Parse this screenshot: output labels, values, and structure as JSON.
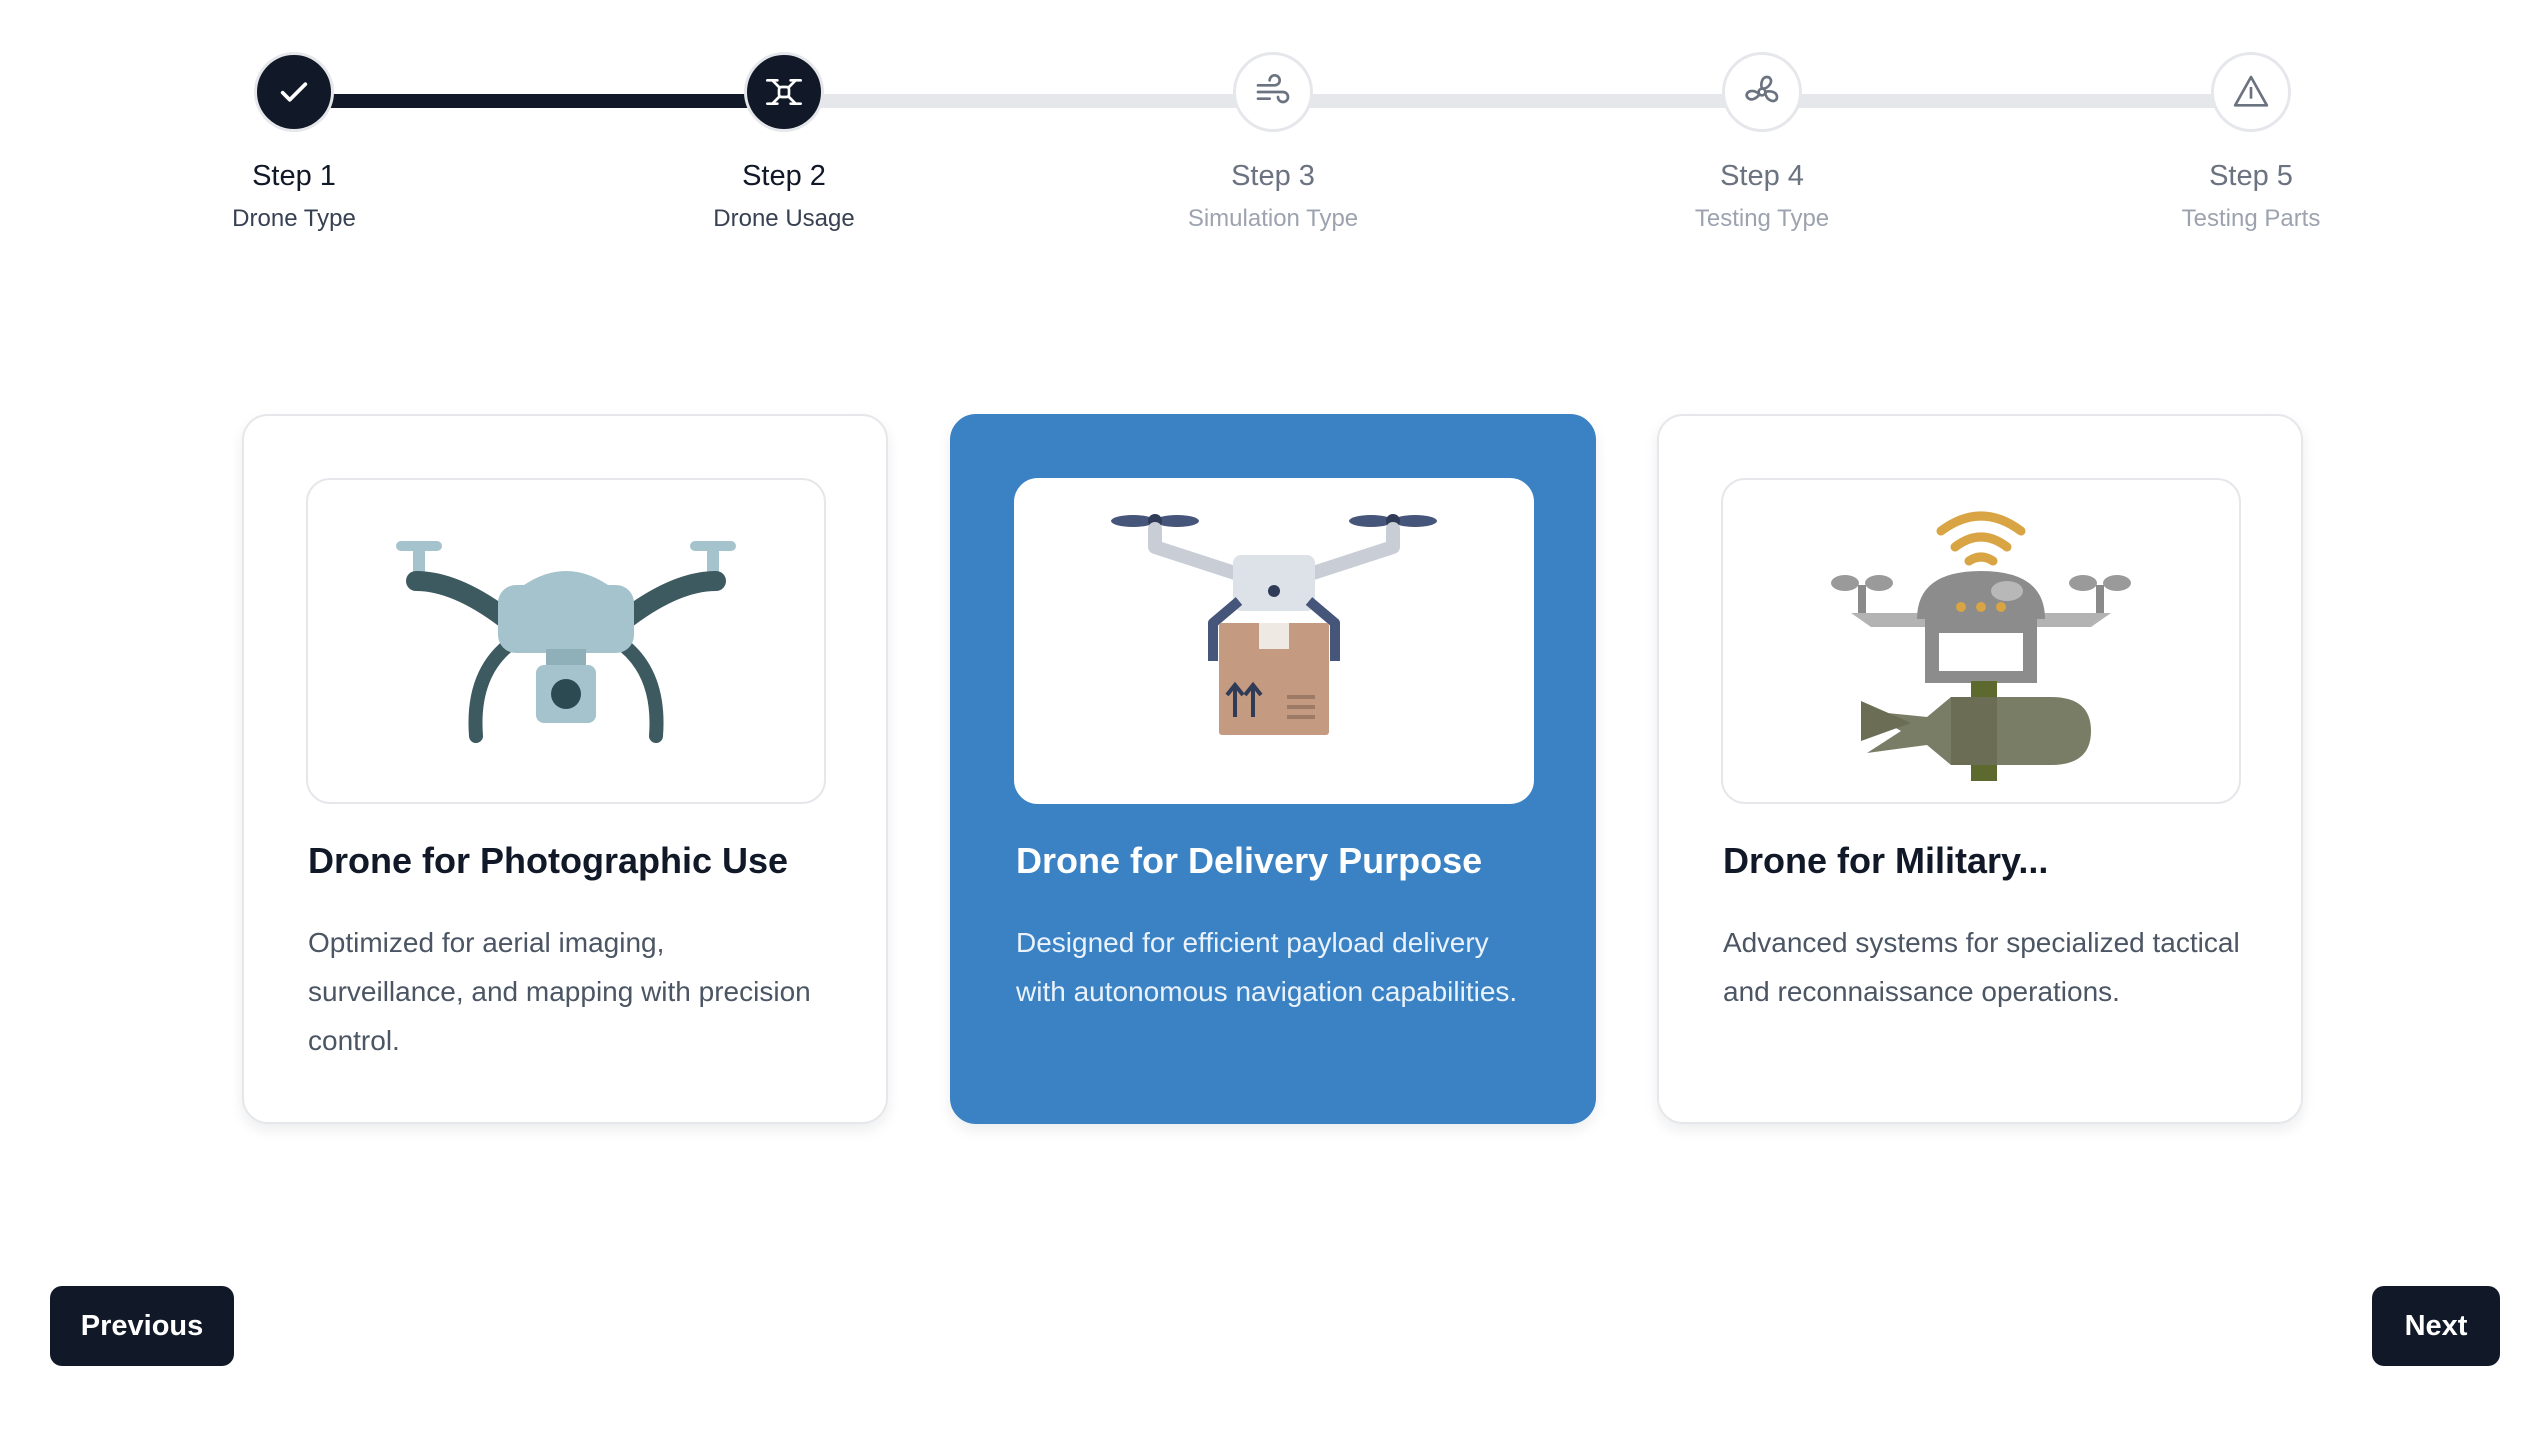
{
  "stepper": {
    "steps": [
      {
        "title": "Step 1",
        "subtitle": "Drone Type",
        "state": "complete",
        "icon": "check-icon"
      },
      {
        "title": "Step 2",
        "subtitle": "Drone Usage",
        "state": "active",
        "icon": "drone-icon"
      },
      {
        "title": "Step 3",
        "subtitle": "Simulation Type",
        "state": "upcoming",
        "icon": "wind-icon"
      },
      {
        "title": "Step 4",
        "subtitle": "Testing Type",
        "state": "upcoming",
        "icon": "fan-icon"
      },
      {
        "title": "Step 5",
        "subtitle": "Testing Parts",
        "state": "upcoming",
        "icon": "warning-triangle-icon"
      }
    ],
    "progress_fraction": 0.25
  },
  "cards": [
    {
      "title": "Drone for Photographic Use",
      "description": "Optimized for aerial imaging, surveillance, and mapping with precision control.",
      "selected": false,
      "icon": "camera-drone-icon"
    },
    {
      "title": "Drone for Delivery Purpose",
      "description": "Designed for efficient payload delivery with autonomous navigation capabilities.",
      "selected": true,
      "icon": "delivery-drone-icon"
    },
    {
      "title": "Drone for Military...",
      "description": "Advanced systems for specialized tactical and reconnaissance operations.",
      "selected": false,
      "icon": "military-drone-icon"
    }
  ],
  "actions": {
    "previous_label": "Previous",
    "next_label": "Next"
  },
  "colors": {
    "primary_dark": "#111827",
    "selected_card": "#3b82c4",
    "track": "#e5e7eb"
  }
}
